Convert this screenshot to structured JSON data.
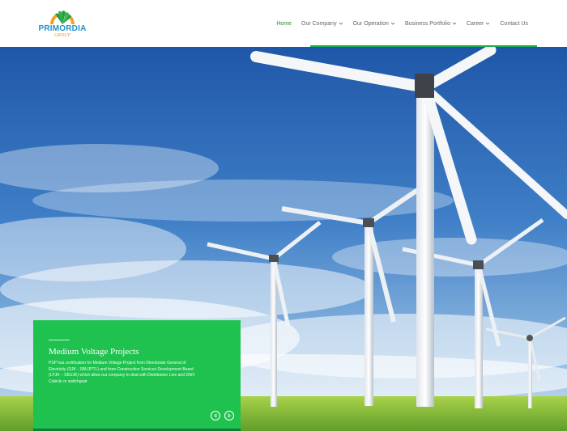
{
  "brand": {
    "name": "PRIMORDIA",
    "sub": "GROUP"
  },
  "nav": {
    "items": [
      {
        "label": "Home"
      },
      {
        "label": "Our Company"
      },
      {
        "label": "Our Operation"
      },
      {
        "label": "Business Portfolio"
      },
      {
        "label": "Career"
      },
      {
        "label": "Contact Us"
      }
    ]
  },
  "slide": {
    "title": "Medium Voltage Projects",
    "text": "PSP has certification for Medium Voltage Project from Directorate General of Electricity (DJK - SBUJPTL) and from Construction Services Development Board (LPJK – SBUJK) which allow our company to deal with Distribution Line and 20kV Cubicle or switchgear"
  },
  "colors": {
    "accent": "#1fc24f",
    "nav_active": "#2e8b2e",
    "logo_blue": "#1f8fcf"
  },
  "icons": {
    "prev": "arrow-left-icon",
    "next": "arrow-right-icon",
    "dropdown": "chevron-down-icon"
  }
}
